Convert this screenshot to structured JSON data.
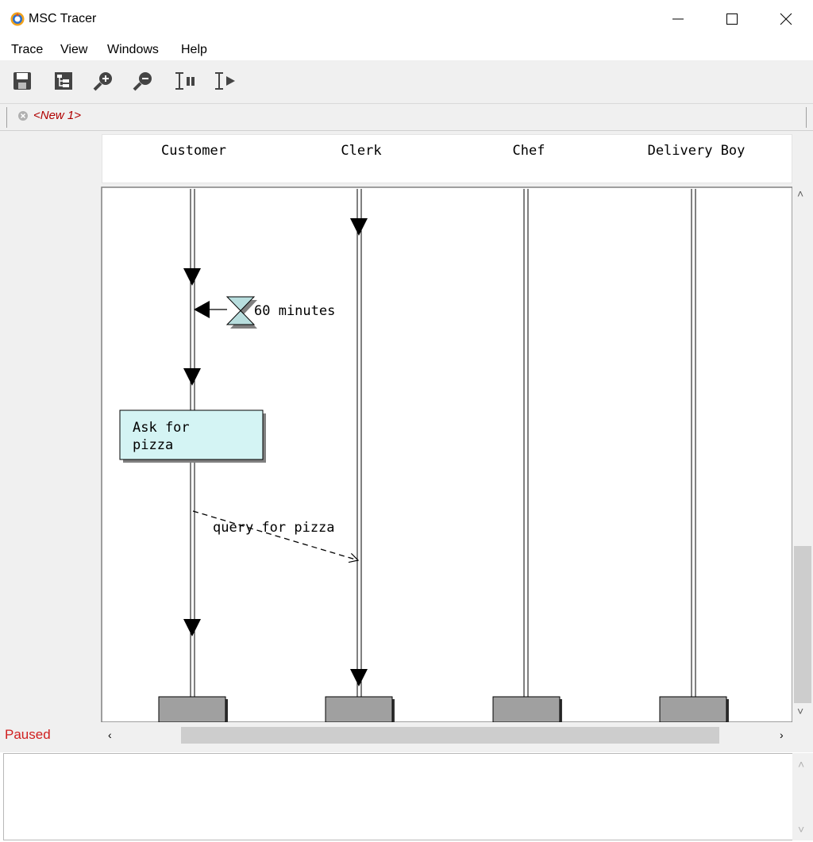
{
  "window": {
    "title": "MSC Tracer"
  },
  "menu": {
    "items": [
      "Trace",
      "View",
      "Windows",
      "Help"
    ]
  },
  "tabs": [
    {
      "label": "<New 1>"
    }
  ],
  "lifelines": [
    "Customer",
    "Clerk",
    "Chef",
    "Delivery Boy"
  ],
  "diagram": {
    "timer_label": "60 minutes",
    "action_box": {
      "line1": "Ask for",
      "line2": "pizza"
    },
    "message_label": "query for pizza"
  },
  "status": {
    "text": "Paused"
  },
  "colors": {
    "status": "#d02020",
    "tab_label": "#b00000",
    "action_box": "#d4f4f4",
    "timer": "#b8dede",
    "end_box": "#a0a0a0"
  },
  "icons": [
    "app-icon",
    "minimize-icon",
    "maximize-icon",
    "close-icon",
    "save-icon",
    "tree-icon",
    "zoom-in-icon",
    "zoom-out-icon",
    "pause-trace-icon",
    "step-trace-icon",
    "tab-close-icon"
  ]
}
